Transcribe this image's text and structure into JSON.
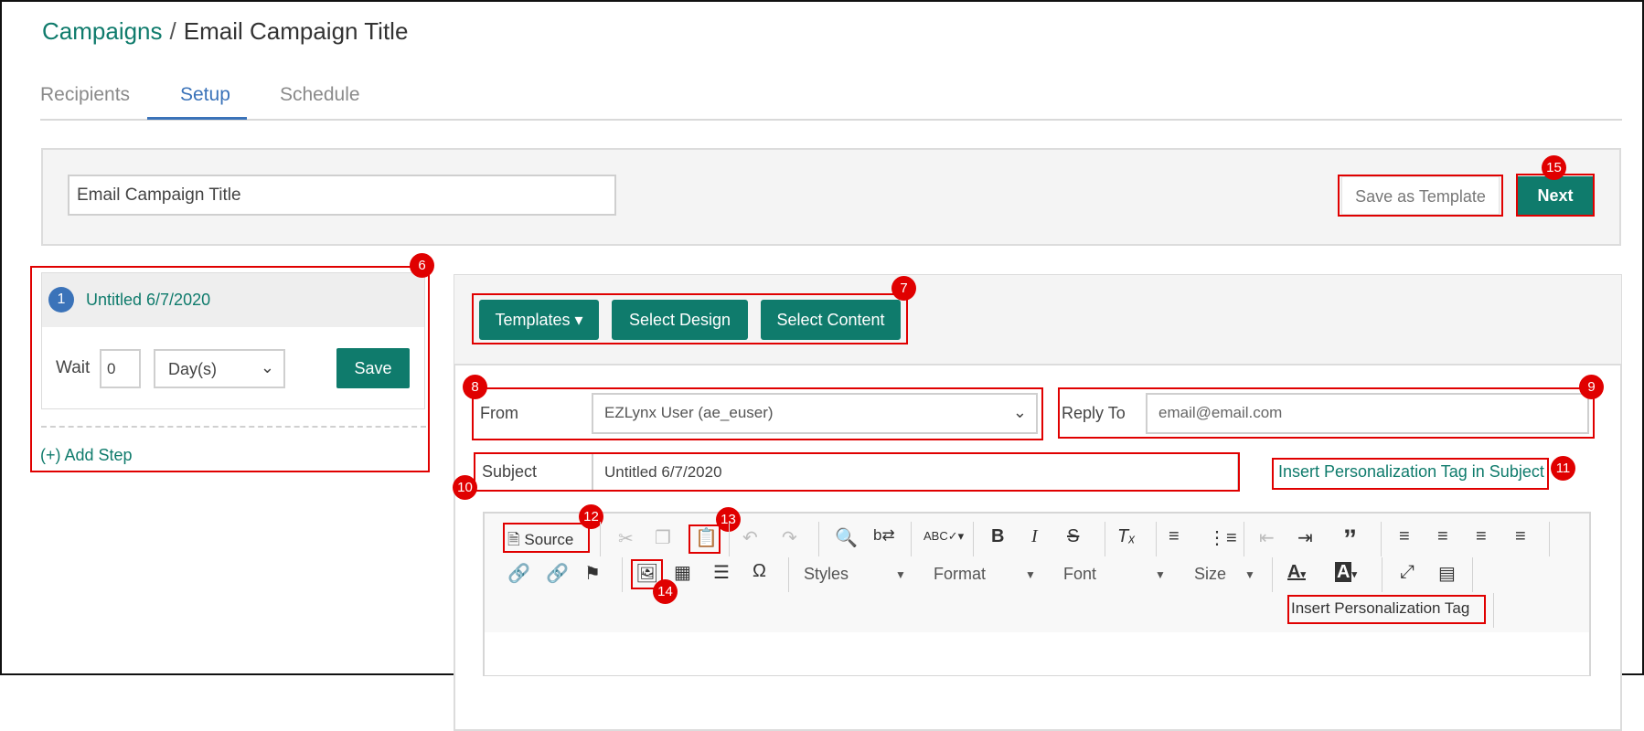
{
  "breadcrumb": {
    "root": "Campaigns",
    "separator": "/",
    "current": "Email Campaign Title"
  },
  "tabs": [
    "Recipients",
    "Setup",
    "Schedule"
  ],
  "active_tab": "Setup",
  "header": {
    "title_value": "Email Campaign Title",
    "save_template_label": "Save as Template",
    "next_label": "Next"
  },
  "steps": {
    "items": [
      {
        "number": "1",
        "name": "Untitled 6/7/2020"
      }
    ],
    "wait_label": "Wait",
    "wait_value": "0",
    "wait_unit": "Day(s)",
    "save_label": "Save",
    "add_step_label": "(+) Add Step"
  },
  "content_buttons": {
    "templates": "Templates",
    "select_design": "Select Design",
    "select_content": "Select Content"
  },
  "fields": {
    "from_label": "From",
    "from_value": "EZLynx User (ae_euser)",
    "reply_label": "Reply To",
    "reply_placeholder": "email@email.com",
    "subject_label": "Subject",
    "subject_value": "Untitled 6/7/2020",
    "insert_subject_tag": "Insert Personalization Tag in Subject"
  },
  "editor": {
    "source_label": "Source",
    "styles": "Styles",
    "format": "Format",
    "font": "Font",
    "size": "Size",
    "insert_tag": "Insert Personalization Tag"
  },
  "callouts": [
    "6",
    "7",
    "8",
    "9",
    "10",
    "11",
    "12",
    "13",
    "14",
    "15"
  ],
  "colors": {
    "accent": "#0f7b6c",
    "tab_active": "#3b73b9",
    "callout": "#e00000"
  }
}
